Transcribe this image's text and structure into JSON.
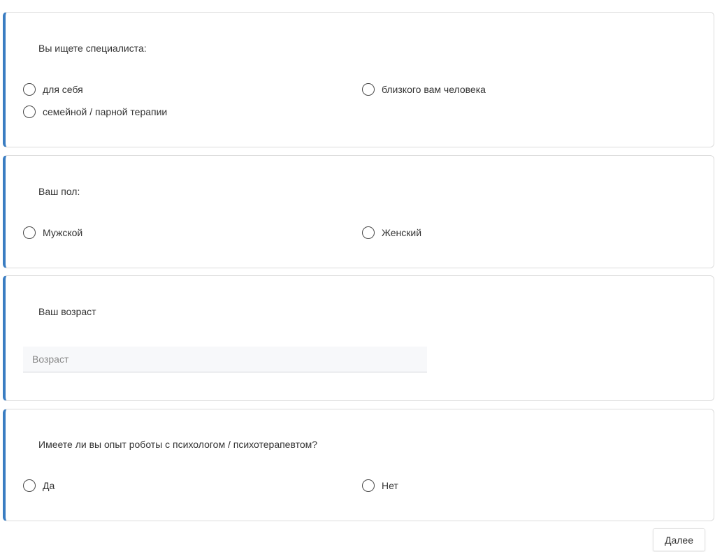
{
  "accent_color": "#3a7dc2",
  "questions": [
    {
      "title": "Вы ищете специалиста:",
      "type": "radio",
      "options": [
        "для себя",
        "близкого вам человека",
        "семейной / парной терапии"
      ]
    },
    {
      "title": "Ваш пол:",
      "type": "radio",
      "options": [
        "Мужской",
        "Женский"
      ]
    },
    {
      "title": "Ваш возраст",
      "type": "text",
      "value": "",
      "placeholder": "Возраст"
    },
    {
      "title": "Имеете ли вы опыт роботы с психологом / психотерапевтом?",
      "type": "radio",
      "options": [
        "Да",
        "Нет"
      ]
    }
  ],
  "footer": {
    "next_label": "Далее"
  }
}
